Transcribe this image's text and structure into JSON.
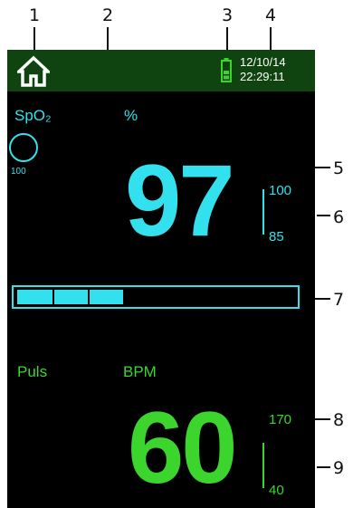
{
  "callouts": [
    "1",
    "2",
    "3",
    "4",
    "5",
    "6",
    "7",
    "8",
    "9"
  ],
  "header": {
    "date": "12/10/14",
    "time": "22:29:11",
    "home_icon": "home-icon",
    "battery_icon": "battery-icon"
  },
  "spo2": {
    "label": "SpO₂",
    "unit": "%",
    "scale_label": "100",
    "value": "97",
    "limit_high": "100",
    "limit_low": "85",
    "color": "#33e1ee"
  },
  "bar": {
    "segments_filled": 3,
    "color": "#33e1ee"
  },
  "pulse": {
    "label": "Puls",
    "unit": "BPM",
    "value": "60",
    "limit_high": "170",
    "limit_low": "40",
    "color": "#3cd52e"
  },
  "header_color": "#0f4410"
}
